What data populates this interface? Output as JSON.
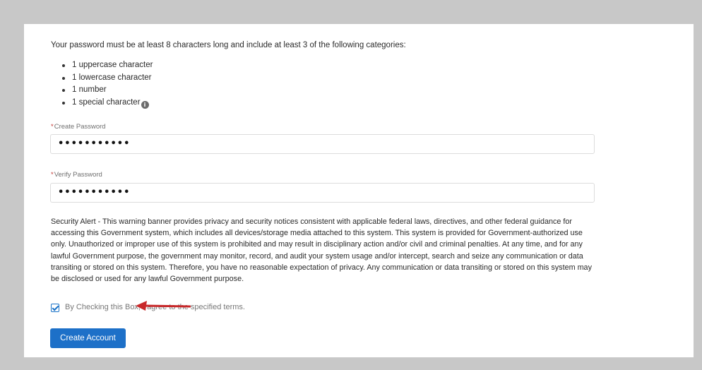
{
  "password_rules": {
    "intro": "Your password must be at least 8 characters long and include at least 3 of the following categories:",
    "items": [
      "1 uppercase character",
      "1 lowercase character",
      "1 number",
      "1 special character"
    ],
    "info_icon": "info-icon"
  },
  "create_password": {
    "required_mark": "*",
    "label": "Create Password",
    "value": "•••••••••••"
  },
  "verify_password": {
    "required_mark": "*",
    "label": "Verify Password",
    "value": "•••••••••••"
  },
  "security_alert": "Security Alert - This warning banner provides privacy and security notices consistent with applicable federal laws, directives, and other federal guidance for accessing this Government system, which includes all devices/storage media attached to this system. This system is provided for Government-authorized use only. Unauthorized or improper use of this system is prohibited and may result in disciplinary action and/or civil and criminal penalties. At any time, and for any lawful Government purpose, the government may monitor, record, and audit your system usage and/or intercept, search and seize any communication or data transiting or stored on this system. Therefore, you have no reasonable expectation of privacy. Any communication or data transiting or stored on this system may be disclosed or used for any lawful Government purpose.",
  "agree": {
    "checked": true,
    "label": "By Checking this Box, I agree to the specified terms."
  },
  "create_account": {
    "label": "Create Account"
  },
  "colors": {
    "accent": "#1d70c8",
    "annotation_arrow": "#c8282a",
    "required": "#c23934"
  }
}
